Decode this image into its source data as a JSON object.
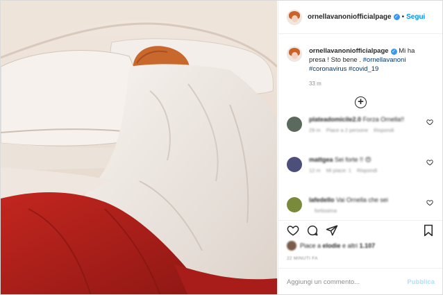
{
  "header": {
    "username": "ornellavanoniofficialpage",
    "separator": "•",
    "follow_label": "Segui"
  },
  "caption": {
    "username": "ornellavanoniofficialpage",
    "text": "Mi ha presa ! Sto bene . ",
    "hashtags": [
      "#ornellavanoni",
      "#coronavirus",
      "#covid_19"
    ],
    "time": "33 m"
  },
  "comments": [
    {
      "username": "plateadomicile2.0",
      "text": "Forza Ornella!!",
      "time": "29 m",
      "likes": "Piace a 2 persone",
      "reply": "Rispondi",
      "avatar_color": "#5a6a5c"
    },
    {
      "username": "mattgea",
      "text": "Sei forte !! 😍",
      "time": "12 m",
      "likes": "Mi piace: 1",
      "reply": "Rispondi",
      "avatar_color": "#4b4f7a"
    },
    {
      "username": "lafedello",
      "text": "Vai Ornella che sei",
      "time": "",
      "likes": "fortissima",
      "reply": "",
      "avatar_color": "#7a8a3c"
    }
  ],
  "likes": {
    "text": "Piace a ",
    "who": "elodie",
    "rest": " e altri ",
    "count": "1.107"
  },
  "date": "22 MINUTI FA",
  "composer": {
    "placeholder": "Aggiungi un commento...",
    "publish_label": "Pubblica"
  },
  "colors": {
    "accent": "#0095f6",
    "verified": "#3897f0",
    "blanket": "#b0201c"
  },
  "icons": [
    "verified-badge-icon",
    "add-comments-icon",
    "heart-icon",
    "comment-icon",
    "share-icon",
    "bookmark-icon"
  ]
}
